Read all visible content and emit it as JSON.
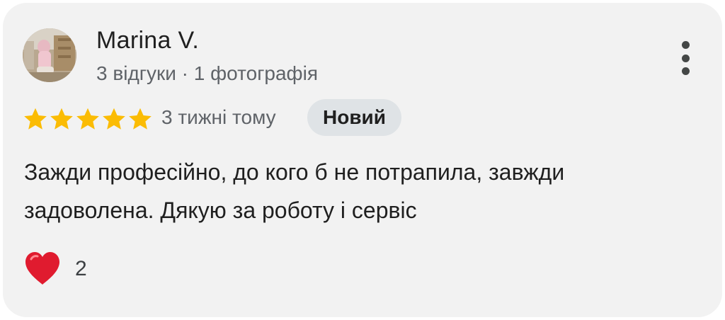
{
  "review": {
    "author": "Marina V.",
    "meta": "3 відгуки · 1 фотографія",
    "rating": 5,
    "rating_max": 5,
    "time": "3 тижні тому",
    "badge": "Новий",
    "text": "Зажди професійно, до кого б не потрапила, завжди задоволена. Дякую за роботу і сервіс",
    "reaction_icon": "red-heart-icon",
    "reaction_count": "2",
    "more_icon": "more-vert-icon"
  },
  "colors": {
    "card_background": "#f2f2f2",
    "star": "#fbbc04",
    "badge_background": "#dfe3e6",
    "heart": "#e01b2f",
    "secondary_text": "#5f6368"
  }
}
